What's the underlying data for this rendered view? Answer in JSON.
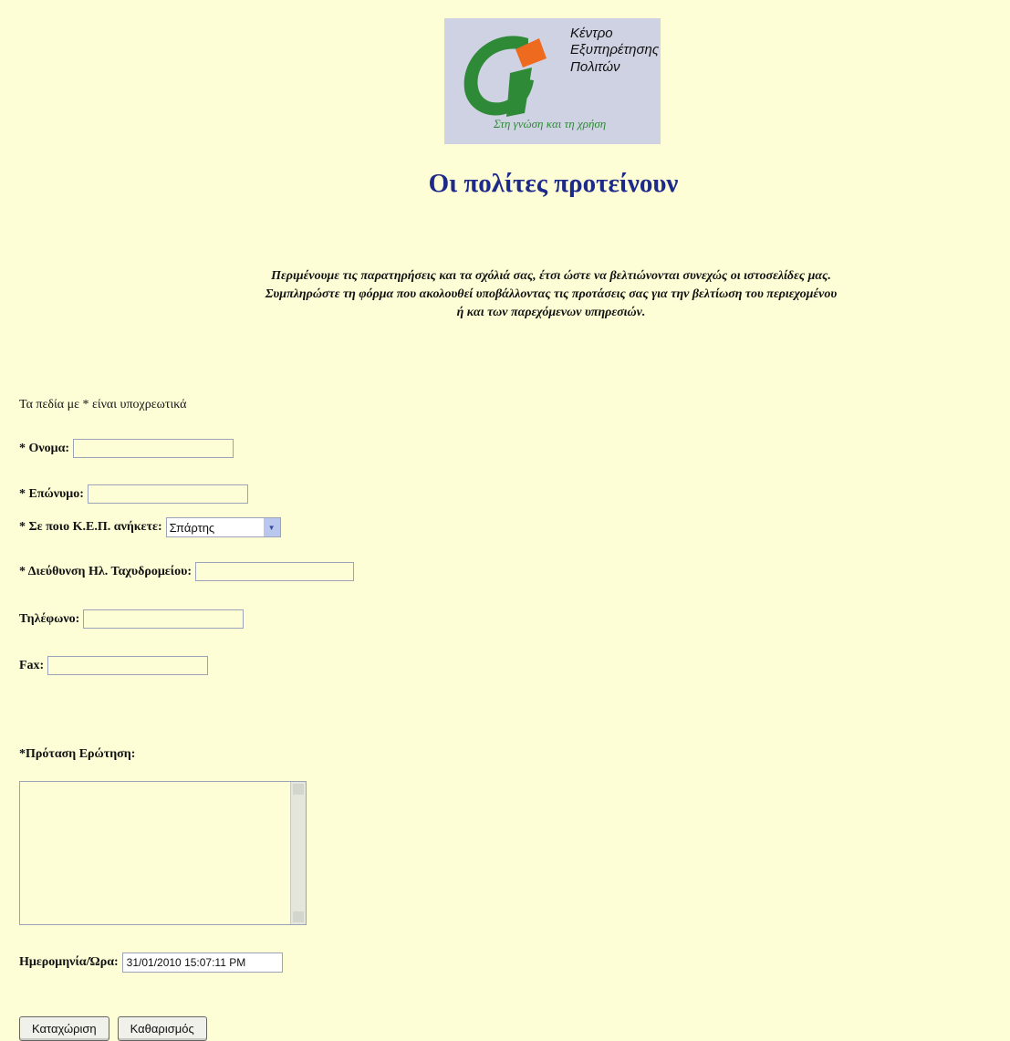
{
  "logo": {
    "line1": "Κέντρο",
    "line2": "Εξυπηρέτησης",
    "line3": "Πολιτών",
    "slogan": "Στη γνώση και τη χρήση"
  },
  "page": {
    "title": "Οι πολίτες προτείνουν",
    "intro_line1": "Περιμένουμε τις παρατηρήσεις και τα σχόλιά σας, έτσι ώστε να βελτιώνονται συνεχώς οι ιστοσελίδες μας.",
    "intro_line2": "Συμπληρώστε τη φόρμα που ακολουθεί υποβάλλοντας τις προτάσεις σας για την βελτίωση του περιεχομένου",
    "intro_line3": "ή και των παρεχόμενων υπηρεσιών.",
    "required_note": "Τα πεδία με * είναι υποχρεωτικά"
  },
  "form": {
    "first_name_label": "* Ονομα:",
    "last_name_label": "* Επώνυμο:",
    "kep_label": "* Σε ποιο Κ.Ε.Π. ανήκετε:",
    "kep_selected": "Σπάρτης",
    "email_label": "* Διεύθυνση Ηλ. Ταχυδρομείου:",
    "phone_label": "Τηλέφωνο:",
    "fax_label": "Fax:",
    "proposal_label": "*Πρόταση Ερώτηση:",
    "datetime_label": "Ημερομηνία/Ώρα:",
    "datetime_value": "31/01/2010 15:07:11 PM",
    "submit_label": "Καταχώριση",
    "clear_label": "Καθαρισμός"
  },
  "colors": {
    "background": "#fdfdd6",
    "title": "#1e2a8a",
    "logo_green": "#2f8a38",
    "logo_orange": "#ee6a1f",
    "logo_bg": "#cfd2e3"
  }
}
